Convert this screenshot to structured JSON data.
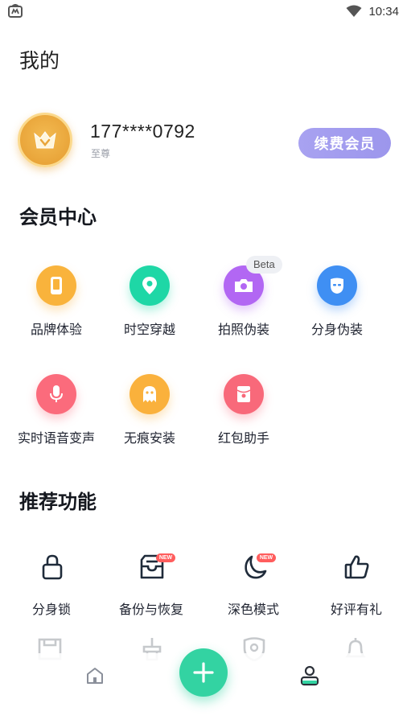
{
  "status_bar": {
    "time": "10:34"
  },
  "page": {
    "title": "我的"
  },
  "profile": {
    "phone": "177****0792",
    "level": "至尊",
    "renew_label": "续费会员"
  },
  "member_center": {
    "title": "会员中心",
    "items": [
      {
        "label": "品牌体验",
        "icon": "phone-icon",
        "color": "#f9b33c"
      },
      {
        "label": "时空穿越",
        "icon": "location-pin-icon",
        "color": "#1ed7a6"
      },
      {
        "label": "拍照伪装",
        "icon": "camera-icon",
        "color": "#b267f3",
        "badge": "Beta"
      },
      {
        "label": "分身伪装",
        "icon": "mask-icon",
        "color": "#3f8ff3"
      },
      {
        "label": "实时语音变声",
        "icon": "microphone-icon",
        "color": "#fb6b7c"
      },
      {
        "label": "无痕安装",
        "icon": "ghost-icon",
        "color": "#fab13c"
      },
      {
        "label": "红包助手",
        "icon": "red-envelope-icon",
        "color": "#f8697a"
      }
    ]
  },
  "recommended": {
    "title": "推荐功能",
    "items": [
      {
        "label": "分身锁",
        "icon": "lock-icon"
      },
      {
        "label": "备份与恢复",
        "icon": "inbox-backup-icon",
        "badge": "NEW"
      },
      {
        "label": "深色模式",
        "icon": "moon-icon",
        "badge": "NEW"
      },
      {
        "label": "好评有礼",
        "icon": "thumbs-up-icon"
      }
    ]
  },
  "bottom_nav": {
    "items": [
      "home-icon",
      "add-icon",
      "profile-icon"
    ]
  },
  "colors": {
    "accent": "#33d3a2",
    "member_button": "#a49ef0"
  }
}
